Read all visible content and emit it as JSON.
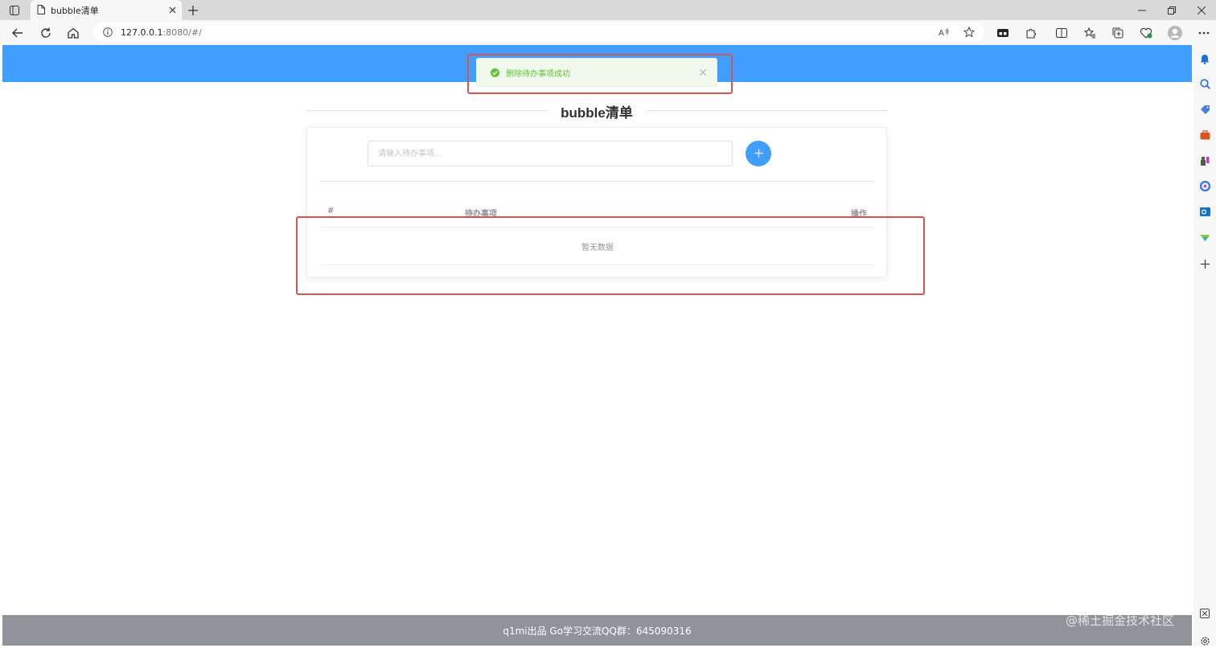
{
  "browser": {
    "tab_title": "bubble清单",
    "url_host": "127.0.0.1",
    "url_rest": ":8080/#/",
    "accent": "#409eff"
  },
  "message": {
    "text": "删除待办事项成功",
    "type": "success",
    "color": "#67c23a"
  },
  "app": {
    "title": "bubble清单",
    "input_placeholder": "请输入待办事项...",
    "add_icon": "plus-icon",
    "table": {
      "columns": [
        "#",
        "待办事项",
        "操作"
      ],
      "empty_text": "暂无数据"
    }
  },
  "footer": {
    "text": "q1mi出品 Go学习交流QQ群：645090316"
  },
  "watermark": "@稀土掘金技术社区"
}
